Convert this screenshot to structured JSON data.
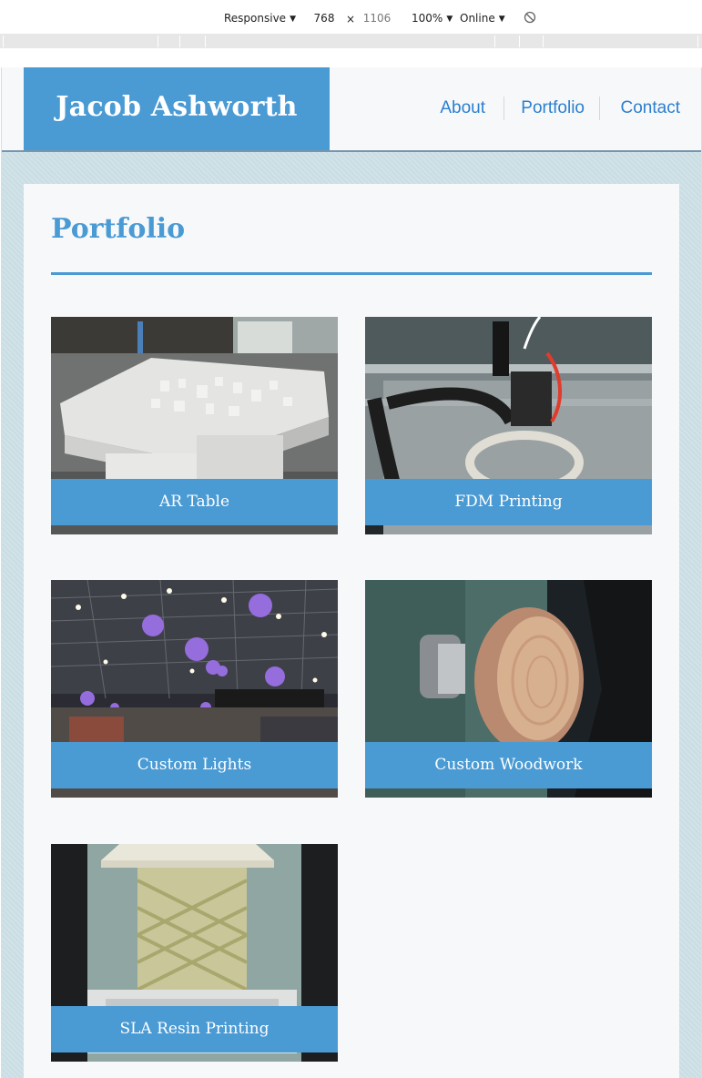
{
  "devtools": {
    "device": "Responsive",
    "width": "768",
    "times": "×",
    "height": "1106",
    "zoom": "100%",
    "throttle": "Online"
  },
  "site": {
    "brand": "Jacob Ashworth",
    "nav": [
      {
        "label": "About"
      },
      {
        "label": "Portfolio"
      },
      {
        "label": "Contact"
      }
    ],
    "page_title": "Portfolio",
    "projects": [
      {
        "title": "AR Table",
        "image": "ar-table-photo"
      },
      {
        "title": "FDM Printing",
        "image": "fdm-printer-photo"
      },
      {
        "title": "Custom Lights",
        "image": "lights-photo"
      },
      {
        "title": "Custom Woodwork",
        "image": "woodwork-bowl-photo"
      },
      {
        "title": "SLA Resin Printing",
        "image": "resin-print-photo"
      }
    ]
  },
  "colors": {
    "accent": "#4a9ad4",
    "nav_link": "#2b7fd0",
    "card_bg": "#f7f8fa",
    "page_bg": "#cde1e7"
  }
}
